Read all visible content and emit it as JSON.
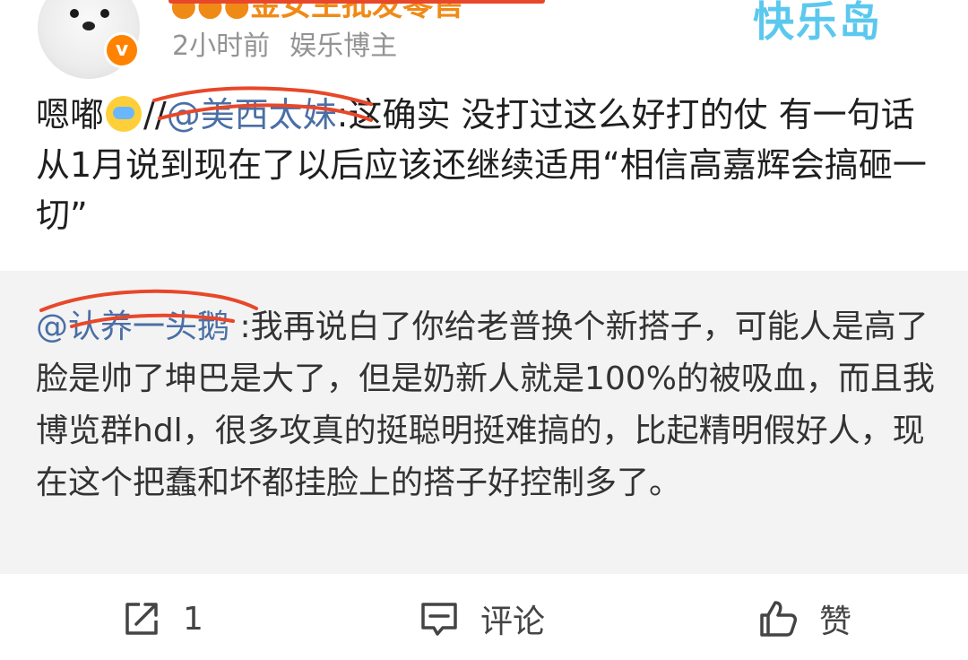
{
  "header": {
    "username": "●●●金女主批发零售",
    "time": "2小时前",
    "category": "娱乐博主",
    "verified_mark": "v",
    "watermark": "快乐岛"
  },
  "post": {
    "prefix": "嗯嘟",
    "slashes": "//",
    "mention": "@美西太妹",
    "body": ":这确实 没打过这么好打的仗 有一句话从1月说到现在了以后应该还继续适用“相信高嘉辉会搞砸一切”"
  },
  "quote": {
    "mention": "@认养一头鹅",
    "body": " :我再说白了你给老普换个新搭子，可能人是高了脸是帅了坤巴是大了，但是奶新人就是100%的被吸血，而且我博览群hdl，很多攻真的挺聪明挺难搞的，比起精明假好人，现在这个把蠢和坏都挂脸上的搭子好控制多了。"
  },
  "footer": {
    "forward_count": "1",
    "comment_label": "评论",
    "like_label": "赞"
  },
  "colors": {
    "accent": "#f08a16",
    "link": "#4a6fa5",
    "scribble": "#e8472a",
    "quote_bg": "#f3f3f3"
  },
  "icons": [
    "forward-icon",
    "comment-icon",
    "like-icon",
    "verified-icon",
    "crying-emoji-icon"
  ]
}
